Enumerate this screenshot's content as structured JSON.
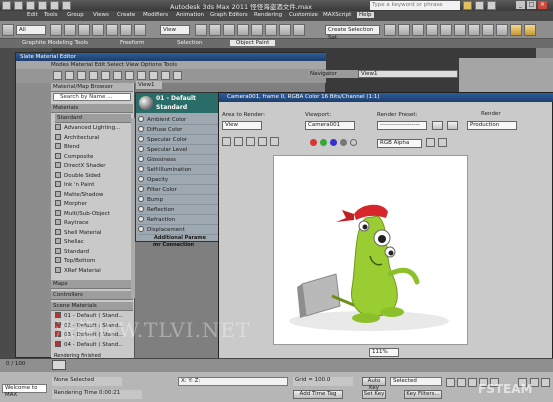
{
  "titlebar": {
    "title": "Autodesk 3ds Max  2011          怪怪海盗酒文件.max",
    "search_placeholder": "Type a keyword or phrase",
    "min": "_",
    "max": "□",
    "close": "×"
  },
  "menu": [
    "Edit",
    "Tools",
    "Group",
    "Views",
    "Create",
    "Modifiers",
    "Animation",
    "Graph Editors",
    "Rendering",
    "Customize",
    "MAXScript",
    "Help"
  ],
  "toolbar": {
    "selection_filter": "All",
    "ref_coord": "View",
    "named_selection": "Create Selection Set"
  },
  "ribbon": [
    "Graphite Modeling Tools",
    "Freeform",
    "Selection",
    "Object Paint"
  ],
  "slate": {
    "title": "Slate Material Editor",
    "menu": "Modes  Material  Edit  Select  View  Options  Tools",
    "browser_title": "Material/Map Browser",
    "search": "Search by Name ...",
    "materials_header": "Materials",
    "standard_header": "Standard",
    "materials": [
      "Advanced Lighting...",
      "Architectural",
      "Blend",
      "Composite",
      "DirectX Shader",
      "Double Sided",
      "Ink 'n Paint",
      "Matte/Shadow",
      "Morpher",
      "Multi/Sub-Object",
      "Raytrace",
      "Shell Material",
      "Shellac",
      "Standard",
      "Top/Bottom",
      "XRef Material"
    ],
    "maps_header": "Maps",
    "controllers_header": "Controllers",
    "scene_header": "Scene Materials",
    "scene_items": [
      "01 - Default  ( Stand...",
      "02 - Default  ( Stand...",
      "03 - Default  ( Stand...",
      "04 - Default  ( Stand..."
    ],
    "status": "Rendering finished",
    "view_tab": "View1",
    "navigator": "Navigator",
    "view_dropdown": "View1"
  },
  "node": {
    "title_line1": "01 - Default",
    "title_line2": "Standard",
    "slots": [
      "Ambient Color",
      "Diffuse Color",
      "Specular Color",
      "Specular Level",
      "Glossiness",
      "Self-Illumination",
      "Opacity",
      "Filter Color",
      "Bump",
      "Reflection",
      "Refraction",
      "Displacement"
    ],
    "footer_line1": "Additional Parame",
    "footer_line2": "mr Connection"
  },
  "render_frame": {
    "title": "Camera001, frame 0, RGBA Color 16 Bits/Channel (1:1)",
    "area_label": "Area to Render:",
    "area_value": "View",
    "viewport_label": "Viewport:",
    "viewport_value": "Camera001",
    "preset_label": "Render Preset:",
    "preset_value": "--------------------",
    "render_button": "Render",
    "production": "Production",
    "channel": "RGB Alpha",
    "zoom": "111%"
  },
  "status": {
    "none_selected": "None Selected",
    "rendering_time": "Rendering Time  0:00:21",
    "welcome": "Welcome to MAX",
    "frame_counter": "0 / 100",
    "grid": "Grid = 100.0",
    "add_time_tag": "Add Time Tag",
    "auto_key": "Auto Key",
    "set_key": "Set Key",
    "key_filters": "Key Filters...",
    "selected": "Selected",
    "xyz": "X:  Y:  Z:"
  },
  "watermark": "涨龍WW.TLVI.NET",
  "watermark2": "FSTEAM",
  "colors": {
    "title_blue": "#2d5d9a",
    "node_teal": "#2a6d68",
    "render_bg": "#ffffff"
  }
}
